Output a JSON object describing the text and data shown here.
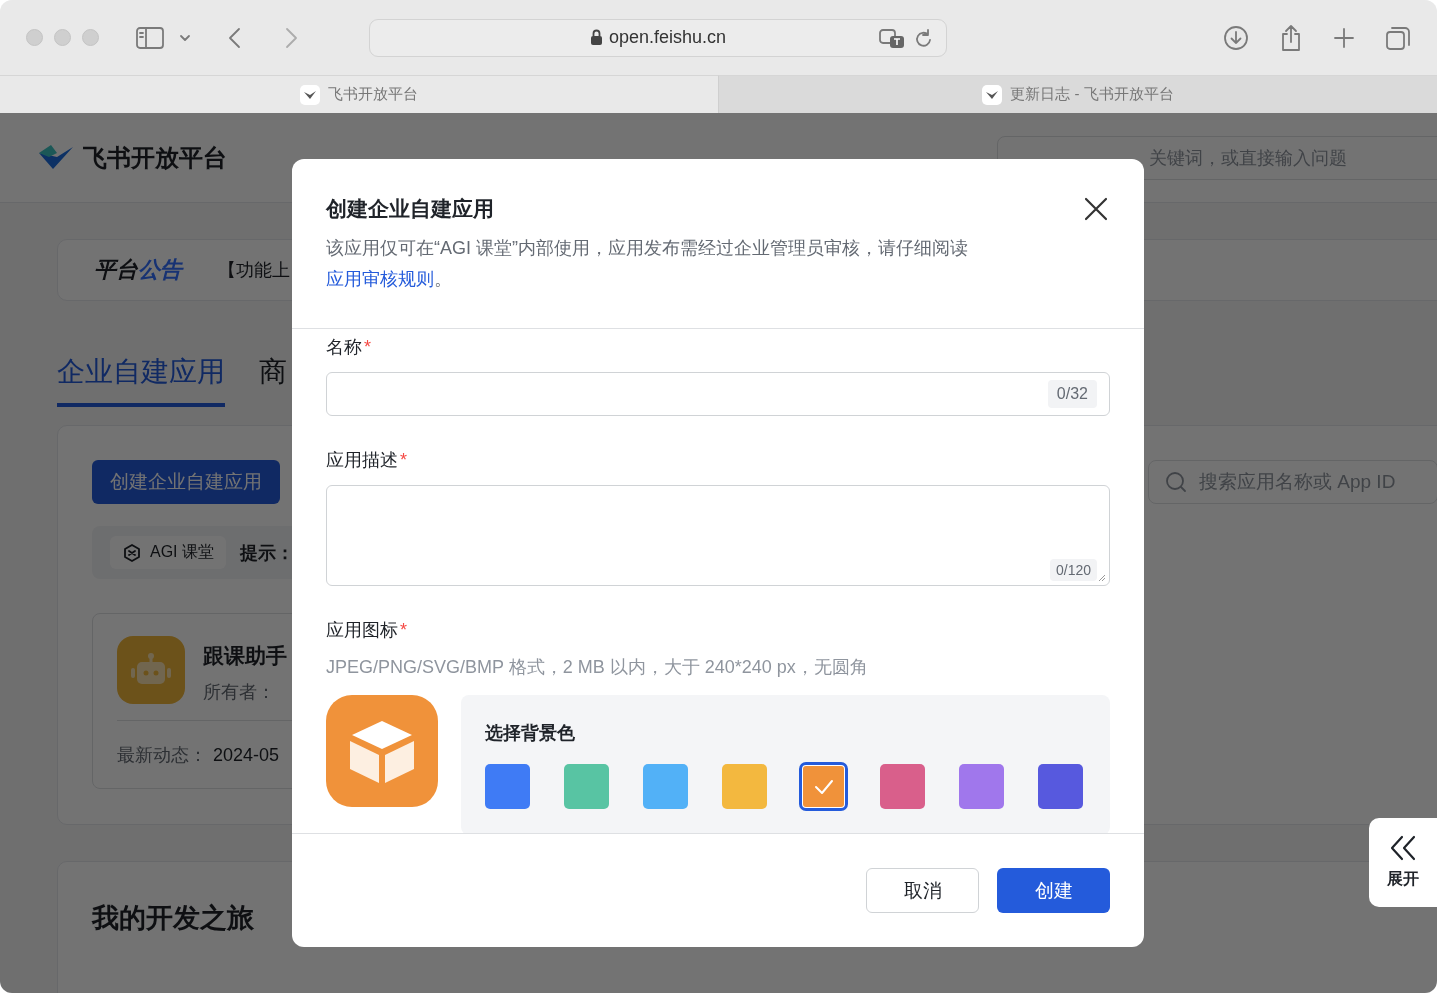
{
  "browser": {
    "url": "open.feishu.cn",
    "tabs": [
      {
        "title": "飞书开放平台",
        "selected": true
      },
      {
        "title": "更新日志 - 飞书开放平台",
        "selected": false
      }
    ]
  },
  "header": {
    "logo_text": "飞书开放平台",
    "search_placeholder": "关键词，或直接输入问题"
  },
  "announcement": {
    "title": "平台",
    "title_accent": "公告",
    "text": "【功能上"
  },
  "tabs": [
    {
      "label": "企业自建应用",
      "selected": true
    },
    {
      "label": "商",
      "selected": false
    }
  ],
  "apps_panel": {
    "create_button": "创建企业自建应用",
    "search_placeholder": "搜索应用名称或 App ID",
    "org_chip": "AGI 课堂",
    "hint_label": "提示：",
    "app_card": {
      "name": "跟课助手",
      "owner_label": "所有者：",
      "activity_label": "最新动态：",
      "activity_value": "2024-05"
    }
  },
  "journey": {
    "title": "我的开发之旅"
  },
  "dialog": {
    "title": "创建企业自建应用",
    "description": "该应用仅可在“AGI 课堂”内部使用，应用发布需经过企业管理员审核，请仔细阅读",
    "link": "应用审核规则",
    "description_end": "。",
    "name_field": {
      "label": "名称",
      "required_mark": "*",
      "counter": "0/32"
    },
    "description_field": {
      "label": "应用描述",
      "required_mark": "*",
      "counter": "0/120"
    },
    "icon_field": {
      "label": "应用图标",
      "required_mark": "*",
      "hint": "JPEG/PNG/SVG/BMP 格式，2 MB 以内，大于 240*240 px，无圆角",
      "palette_title": "选择背景色",
      "colors": [
        {
          "color": "#3f7bf5",
          "selected": false
        },
        {
          "color": "#58c4a3",
          "selected": false
        },
        {
          "color": "#52b1f7",
          "selected": false
        },
        {
          "color": "#f3b83f",
          "selected": false
        },
        {
          "color": "#f0923a",
          "selected": true
        },
        {
          "color": "#d95f8b",
          "selected": false
        },
        {
          "color": "#a077ec",
          "selected": false
        },
        {
          "color": "#5759de",
          "selected": false
        }
      ]
    },
    "cancel_button": "取消",
    "create_button": "创建"
  },
  "expand_tab": {
    "label": "展开"
  }
}
